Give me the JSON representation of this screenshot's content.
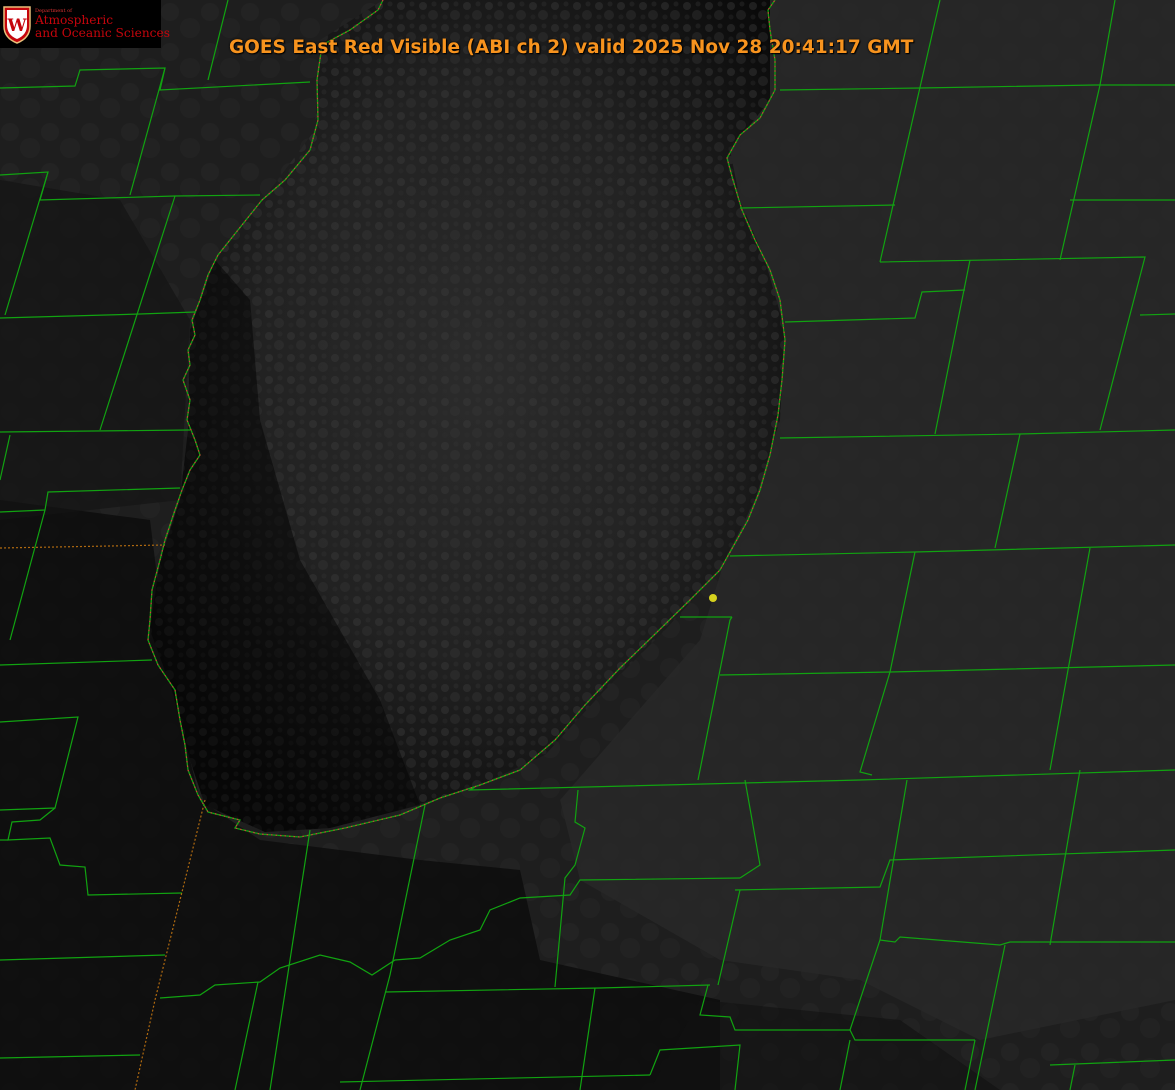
{
  "header": {
    "title": "GOES East Red Visible (ABI ch 2) valid 2025 Nov 28 20:41:17 GMT"
  },
  "logo": {
    "dept": "Department of",
    "line1": "Atmospheric",
    "line2": "and Oceanic Sciences",
    "crest_letter": "W"
  },
  "map": {
    "image_type": "satellite visible imagery",
    "colors": {
      "county_lines": "#11a311",
      "state_line": "#b06a10",
      "lake_outline": "#d23a3a",
      "marker": "#d6d21e",
      "title": "#f7931e"
    },
    "marker": {
      "icon": "location-dot"
    }
  }
}
